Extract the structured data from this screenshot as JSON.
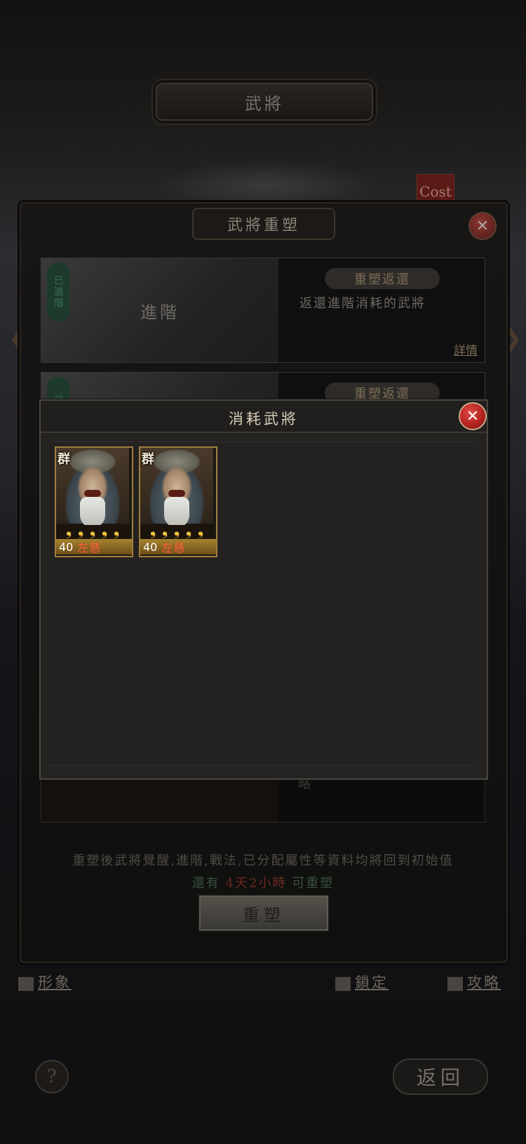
{
  "screen": {
    "title": "武將"
  },
  "cost_tag": "Cost",
  "rebuild_panel": {
    "title": "武將重塑",
    "rows": [
      {
        "badge": "已進階",
        "left_label": "進階",
        "pill": "重塑返還",
        "description": "返還進階消耗的武將",
        "link": "詳情"
      },
      {
        "badge": "已覺",
        "pill": "重塑返還"
      }
    ],
    "bottom_row_text": "略",
    "notice": "重塑後武將覺醒,進階,戰法,已分配屬性等資料均將回到初始值",
    "countdown_prefix": "還有",
    "countdown_value": "4天2小時",
    "countdown_suffix": "可重塑",
    "rebuild_button": "重塑"
  },
  "modal": {
    "title": "消耗武將",
    "close_symbol": "✕",
    "generals": [
      {
        "faction": "群",
        "stars": 5,
        "level": "40",
        "name": "左慈"
      },
      {
        "faction": "群",
        "stars": 5,
        "level": "40",
        "name": "左慈"
      }
    ]
  },
  "footer": {
    "appearance": "形象",
    "lock": "鎖定",
    "guide": "攻略",
    "help": "?",
    "back": "返回"
  },
  "colors": {
    "star": "#f0c23a",
    "name_red": "#ff5a3a",
    "card_border": "#a47e3f"
  }
}
